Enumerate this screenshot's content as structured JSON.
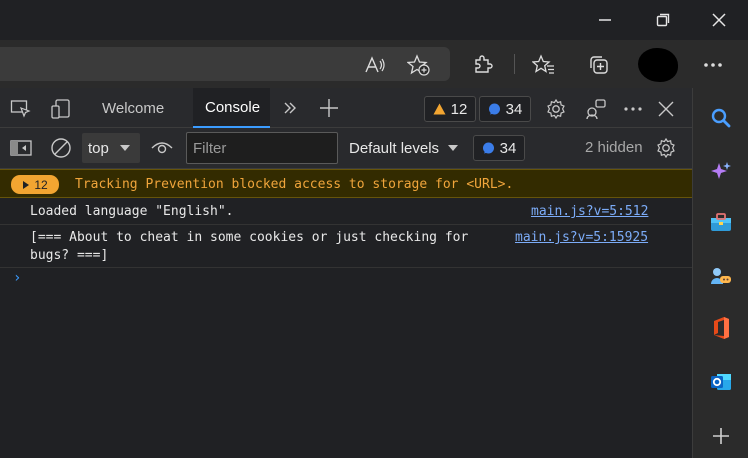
{
  "devtools": {
    "tabs": [
      {
        "label": "Welcome"
      },
      {
        "label": "Console"
      }
    ],
    "warnings_count": "12",
    "messages_count": "34"
  },
  "filterbar": {
    "context": "top",
    "filter_placeholder": "Filter",
    "levels_label": "Default levels",
    "issues_count": "34",
    "hidden_label": "2 hidden"
  },
  "console": {
    "warning": {
      "count": "12",
      "text": "Tracking Prevention blocked access to storage for <URL>."
    },
    "messages": [
      {
        "text_line1": "Loaded language \"English\".",
        "text_line2": "",
        "source": "main.js?v=5:512"
      },
      {
        "text_line1": "[=== About to cheat in some cookies or just checking for",
        "text_line2": "bugs? ===]",
        "source": "main.js?v=5:15925"
      }
    ],
    "prompt": "›"
  },
  "colors": {
    "accent": "#3b9cff",
    "warning": "#f0a53b",
    "link": "#7cacf8"
  }
}
